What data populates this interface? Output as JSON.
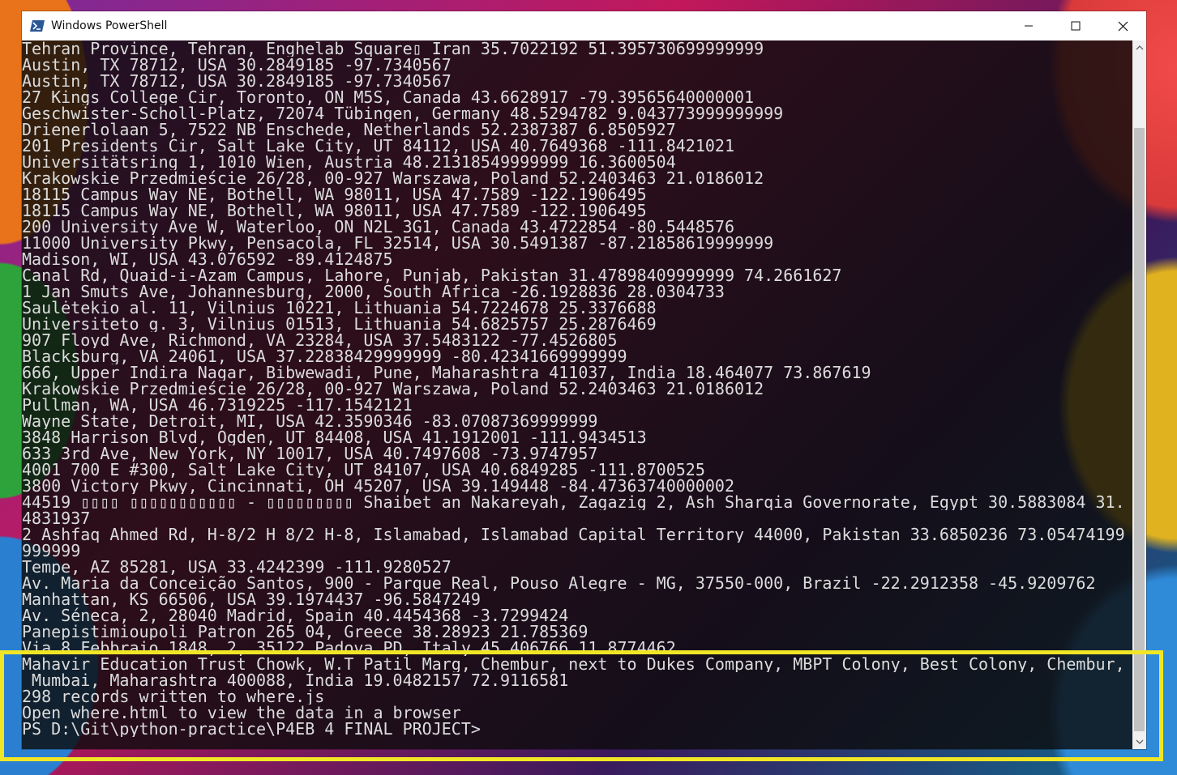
{
  "window": {
    "title": "Windows PowerShell",
    "icon": "powershell-icon",
    "controls": [
      "minimize-icon",
      "maximize-icon",
      "close-icon"
    ]
  },
  "terminal": {
    "lines": [
      "Tehran Province, Tehran, Enghelab Square▯ Iran 35.7022192 51.395730699999999",
      "Austin, TX 78712, USA 30.2849185 -97.7340567",
      "Austin, TX 78712, USA 30.2849185 -97.7340567",
      "27 Kings College Cir, Toronto, ON M5S, Canada 43.6628917 -79.39565640000001",
      "Geschwister-Scholl-Platz, 72074 Tübingen, Germany 48.5294782 9.043773999999999",
      "Drienerlolaan 5, 7522 NB Enschede, Netherlands 52.2387387 6.8505927",
      "201 Presidents Cir, Salt Lake City, UT 84112, USA 40.7649368 -111.8421021",
      "Universitätsring 1, 1010 Wien, Austria 48.21318549999999 16.3600504",
      "Krakowskie Przedmieście 26/28, 00-927 Warszawa, Poland 52.2403463 21.0186012",
      "18115 Campus Way NE, Bothell, WA 98011, USA 47.7589 -122.1906495",
      "18115 Campus Way NE, Bothell, WA 98011, USA 47.7589 -122.1906495",
      "200 University Ave W, Waterloo, ON N2L 3G1, Canada 43.4722854 -80.5448576",
      "11000 University Pkwy, Pensacola, FL 32514, USA 30.5491387 -87.21858619999999",
      "Madison, WI, USA 43.076592 -89.4124875",
      "Canal Rd, Quaid-i-Azam Campus, Lahore, Punjab, Pakistan 31.47898409999999 74.2661627",
      "1 Jan Smuts Ave, Johannesburg, 2000, South Africa -26.1928836 28.0304733",
      "Saulėtekio al. 11, Vilnius 10221, Lithuania 54.7224678 25.3376688",
      "Universiteto g. 3, Vilnius 01513, Lithuania 54.6825757 25.2876469",
      "907 Floyd Ave, Richmond, VA 23284, USA 37.5483122 -77.4526805",
      "Blacksburg, VA 24061, USA 37.22838429999999 -80.42341669999999",
      "666, Upper Indira Nagar, Bibwewadi, Pune, Maharashtra 411037, India 18.464077 73.867619",
      "Krakowskie Przedmieście 26/28, 00-927 Warszawa, Poland 52.2403463 21.0186012",
      "Pullman, WA, USA 46.7319225 -117.1542121",
      "Wayne State, Detroit, MI, USA 42.3590346 -83.07087369999999",
      "3848 Harrison Blvd, Ogden, UT 84408, USA 41.1912001 -111.9434513",
      "633 3rd Ave, New York, NY 10017, USA 40.7497608 -73.9747957",
      "4001 700 E #300, Salt Lake City, UT 84107, USA 40.6849285 -111.8700525",
      "3800 Victory Pkwy, Cincinnati, OH 45207, USA 39.149448 -84.47363740000002",
      "44519 ▯▯▯▯ ▯▯▯▯▯▯▯▯▯▯▯ - ▯▯▯▯▯▯▯▯▯ Shaibet an Nakareyah, Zagazig 2, Ash Sharqia Governorate, Egypt 30.5883084 31.",
      "4831937",
      "2 Ashfaq Ahmed Rd, H-8/2 H 8/2 H-8, Islamabad, Islamabad Capital Territory 44000, Pakistan 33.6850236 73.05474199",
      "999999",
      "Tempe, AZ 85281, USA 33.4242399 -111.9280527",
      "Av. Maria da Conceição Santos, 900 - Parque Real, Pouso Alegre - MG, 37550-000, Brazil -22.2912358 -45.9209762",
      "Manhattan, KS 66506, USA 39.1974437 -96.5847249",
      "Av. Séneca, 2, 28040 Madrid, Spain 40.4454368 -3.7299424",
      "Panepistimioupoli Patron 265 04, Greece 38.28923 21.785369",
      "Via 8 Febbraio 1848, 2, 35122 Padova PD, Italy 45.406766 11.8774462",
      "Mahavir Education Trust Chowk, W.T Patil Marg, Chembur, next to Dukes Company, MBPT Colony, Best Colony, Chembur,",
      " Mumbai, Maharashtra 400088, India 19.0482157 72.9116581",
      "298 records written to where.js",
      "Open where.html to view the data in a browser",
      "PS D:\\Git\\python-practice\\P4EB_4_FINAL_PROJECT>"
    ]
  },
  "scrollbar": {
    "up_icon": "chevron-up-icon",
    "down_icon": "chevron-down-icon"
  },
  "colors": {
    "terminal_text": "#dcdcdc",
    "terminal_bg": "#0c0c0c",
    "highlight": "#f0e626"
  }
}
